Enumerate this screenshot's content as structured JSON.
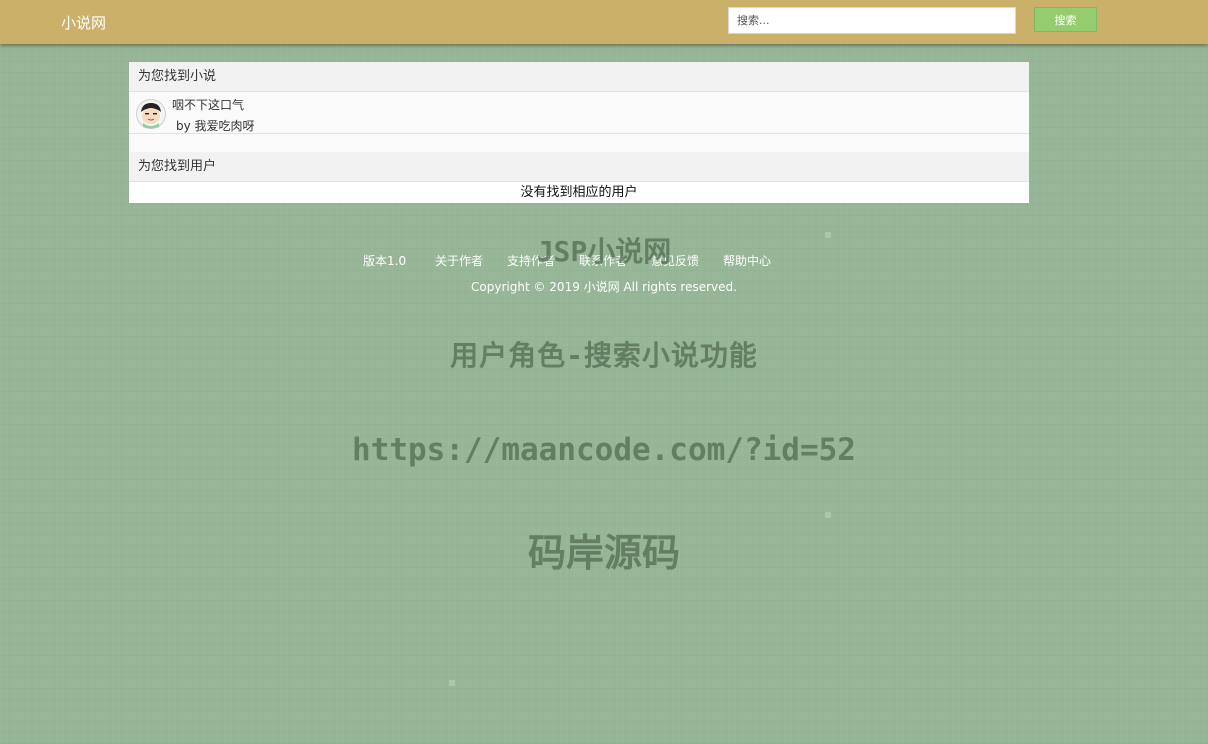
{
  "navbar": {
    "brand": "小说网",
    "search_placeholder": "搜索...",
    "search_button": "搜索"
  },
  "results": {
    "novels_heading": "为您找到小说",
    "novels": [
      {
        "title": "咽不下这口气",
        "author": "by 我爱吃肉呀"
      }
    ],
    "users_heading": "为您找到用户",
    "users_empty": "没有找到相应的用户"
  },
  "footer": {
    "links": [
      "版本1.0",
      "关于作者",
      "支持作者",
      "联系作者",
      "意见反馈",
      "帮助中心"
    ],
    "copyright": "Copyright © 2019 小说网 All rights reserved."
  },
  "watermark": {
    "line1": "JSP小说网",
    "line2": "用户角色-搜索小说功能",
    "line3": "https://maancode.com/?id=52",
    "line4": "码岸源码"
  },
  "colors": {
    "background": "#96b697",
    "navbar": "#cbb06a",
    "search_button": "#95cc6e"
  }
}
